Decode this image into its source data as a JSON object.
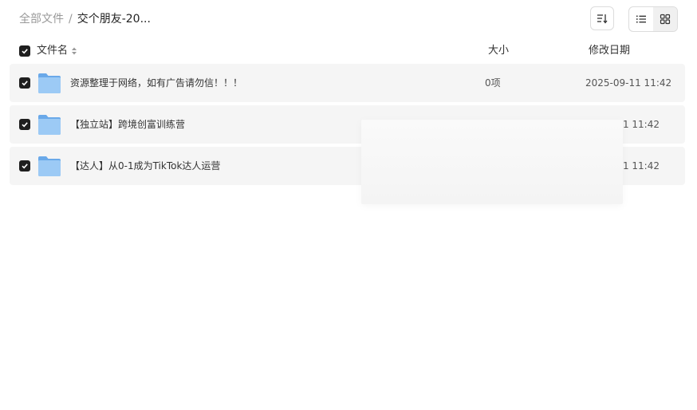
{
  "breadcrumb": {
    "root": "全部文件",
    "separator": "/",
    "current": "交个朋友-20..."
  },
  "toolbar": {
    "sort_icon": "sort-icon",
    "list_view_icon": "list-view-icon",
    "grid_view_icon": "grid-view-icon",
    "active_view": "list"
  },
  "columns": {
    "name": "文件名",
    "size": "大小",
    "date": "修改日期"
  },
  "rows": [
    {
      "name": "资源整理于网络，如有广告请勿信！！！",
      "size": "0项",
      "date": "2025-09-11 11:42",
      "checked": true
    },
    {
      "name": "【独立站】跨境创富训练营",
      "size": "",
      "date": "-11 11:42",
      "checked": true
    },
    {
      "name": "【达人】从0-1成为TikTok达人运营",
      "size": "",
      "date": "-11 11:42",
      "checked": true
    }
  ],
  "colors": {
    "row_bg": "#f5f5f5",
    "checkbox": "#1f1f1f",
    "folder": "#7fb6ec"
  }
}
